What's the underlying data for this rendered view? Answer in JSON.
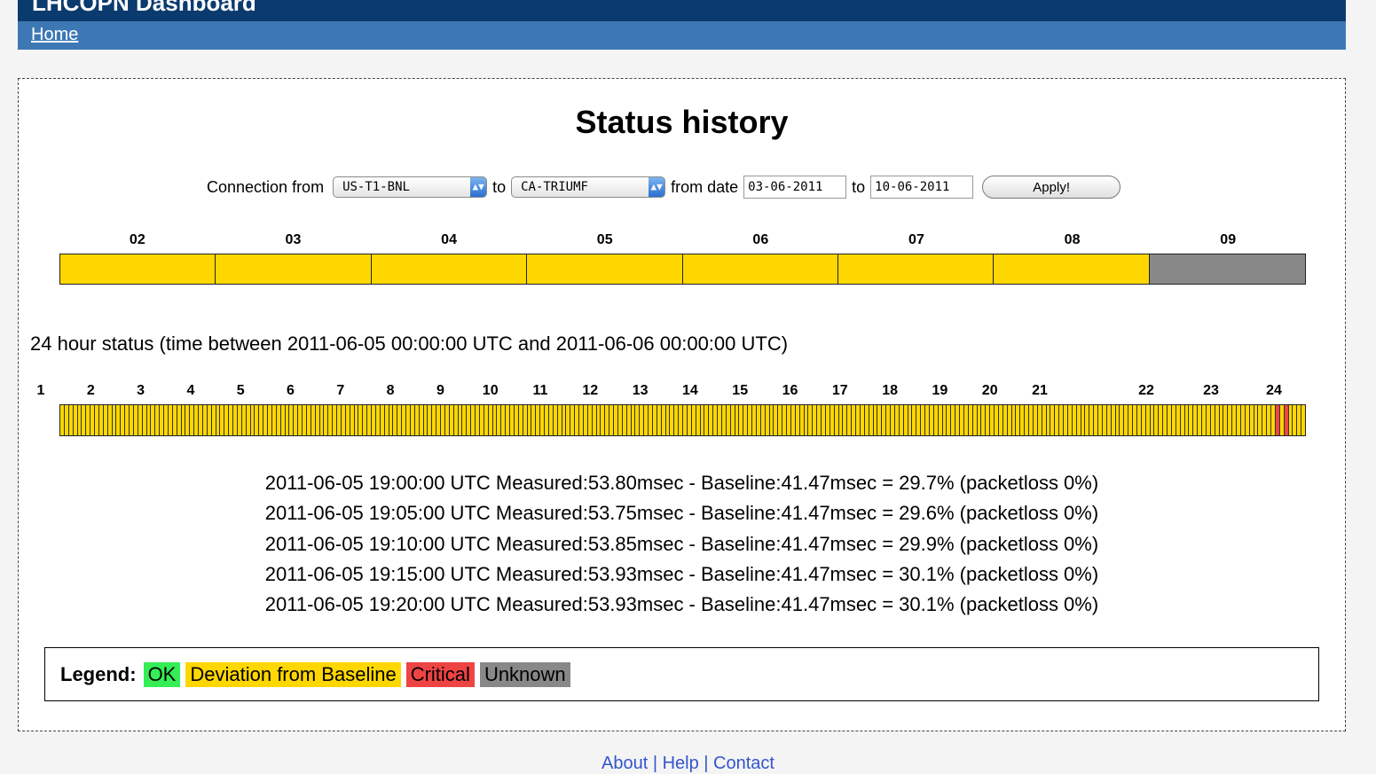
{
  "app": {
    "title": "LHCOPN Dashboard"
  },
  "nav": {
    "home_label": "Home"
  },
  "page": {
    "title": "Status history"
  },
  "filters": {
    "connection_from_label": "Connection from",
    "from_value": "US-T1-BNL",
    "to_label": "to",
    "to_value": "CA-TRIUMF",
    "from_date_label": "from date",
    "start_date": "03-06-2011",
    "to_date_label": "to",
    "end_date": "10-06-2011",
    "apply_label": "Apply!"
  },
  "colors": {
    "ok": "#33ee55",
    "deviation": "#ffd700",
    "critical": "#ee4444",
    "unknown": "#888888"
  },
  "days": [
    {
      "label": "02",
      "status": "deviation",
      "share": 1.0
    },
    {
      "label": "03",
      "status": "deviation",
      "share": 1.0
    },
    {
      "label": "04",
      "status": "deviation",
      "share": 1.0
    },
    {
      "label": "05",
      "status": "deviation",
      "share": 1.0
    },
    {
      "label": "06",
      "status": "deviation",
      "share": 1.0
    },
    {
      "label": "07",
      "status": "deviation",
      "share": 1.0
    },
    {
      "label": "08",
      "status": "deviation",
      "share": 1.0
    },
    {
      "label": "09",
      "status": "unknown",
      "share": 1.0
    }
  ],
  "day24": {
    "title": "24 hour status (time between 2011-06-05 00:00:00 UTC and 2011-06-06 00:00:00 UTC)",
    "hours": [
      "1",
      "2",
      "3",
      "4",
      "5",
      "6",
      "7",
      "8",
      "9",
      "10",
      "11",
      "12",
      "13",
      "14",
      "15",
      "16",
      "17",
      "18",
      "19",
      "20",
      "21",
      "22",
      "23",
      "24"
    ],
    "interval_count": 288,
    "critical_intervals": [
      281,
      283
    ],
    "default_status": "deviation"
  },
  "measurements": [
    "2011-06-05 19:00:00 UTC Measured:53.80msec - Baseline:41.47msec = 29.7% (packetloss 0%)",
    "2011-06-05 19:05:00 UTC Measured:53.75msec - Baseline:41.47msec = 29.6% (packetloss 0%)",
    "2011-06-05 19:10:00 UTC Measured:53.85msec - Baseline:41.47msec = 29.9% (packetloss 0%)",
    "2011-06-05 19:15:00 UTC Measured:53.93msec - Baseline:41.47msec = 30.1% (packetloss 0%)",
    "2011-06-05 19:20:00 UTC Measured:53.93msec - Baseline:41.47msec = 30.1% (packetloss 0%)"
  ],
  "legend": {
    "label": "Legend:",
    "ok": "OK",
    "deviation": "Deviation from Baseline",
    "critical": "Critical",
    "unknown": "Unknown"
  },
  "footer": {
    "text": "About | Help | Contact"
  }
}
